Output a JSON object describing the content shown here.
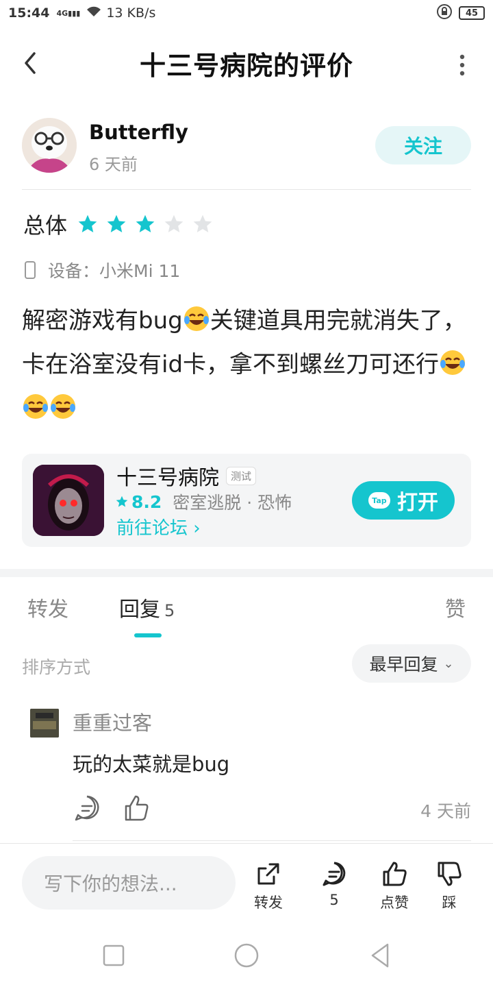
{
  "status": {
    "time": "15:44",
    "net": "4G",
    "speed": "13 KB/s",
    "battery": "45"
  },
  "header": {
    "title": "十三号病院的评价"
  },
  "author": {
    "name": "Butterfly",
    "time": "6 天前",
    "follow_label": "关注"
  },
  "rating": {
    "label": "总体",
    "score": 3,
    "max": 5,
    "accent": "#15c5ce"
  },
  "device": {
    "text": "设备：小米Mi 11"
  },
  "review": {
    "part1": "解密游戏有bug",
    "part2": "关键道具用完就消失了，卡在浴室没有id卡，拿不到螺丝刀可还行"
  },
  "game": {
    "name": "十三号病院",
    "tag": "测试",
    "score": "8.2",
    "genres": "密室逃脱 · 恐怖",
    "forum_link": "前往论坛",
    "open_label": "打开",
    "tap_badge": "Tap"
  },
  "tabs": {
    "repost": "转发",
    "reply": "回复",
    "reply_count": "5",
    "likes": "赞"
  },
  "sort": {
    "label": "排序方式",
    "option": "最早回复"
  },
  "comment": {
    "user": "重重过客",
    "text": "玩的太菜就是bug",
    "time": "4 天前"
  },
  "bottom": {
    "placeholder": "写下你的想法...",
    "share": "转发",
    "comments": "5",
    "like": "点赞",
    "dislike": "踩"
  }
}
